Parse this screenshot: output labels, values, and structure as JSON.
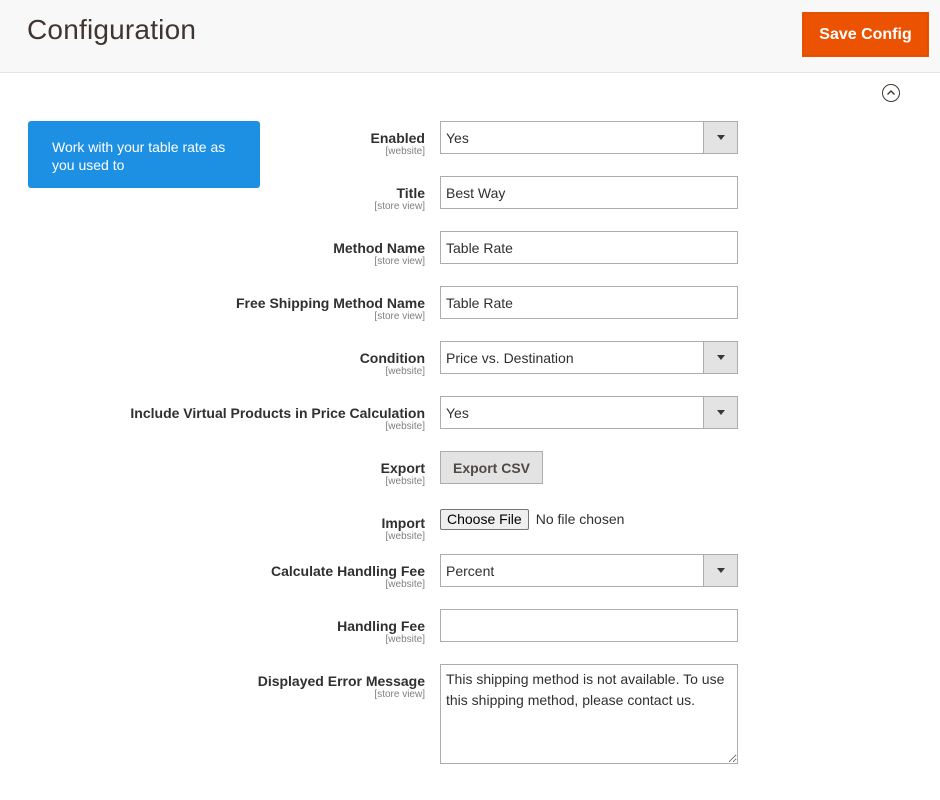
{
  "header": {
    "title": "Configuration",
    "save_button": "Save Config"
  },
  "section": {
    "collapse_icon": "chevron-up-circle-icon",
    "promo_text": "Work with your table rate as you used to"
  },
  "fields": {
    "enabled": {
      "label": "Enabled",
      "scope": "[website]",
      "value": "Yes"
    },
    "title": {
      "label": "Title",
      "scope": "[store view]",
      "value": "Best Way"
    },
    "method_name": {
      "label": "Method Name",
      "scope": "[store view]",
      "value": "Table Rate"
    },
    "free_shipping_method_name": {
      "label": "Free Shipping Method Name",
      "scope": "[store view]",
      "value": "Table Rate"
    },
    "condition": {
      "label": "Condition",
      "scope": "[website]",
      "value": "Price vs. Destination"
    },
    "include_virtual": {
      "label": "Include Virtual Products in Price Calculation",
      "scope": "[website]",
      "value": "Yes"
    },
    "export": {
      "label": "Export",
      "scope": "[website]",
      "button": "Export CSV"
    },
    "import": {
      "label": "Import",
      "scope": "[website]",
      "button": "Choose File",
      "status": "No file chosen"
    },
    "calc_handling_fee": {
      "label": "Calculate Handling Fee",
      "scope": "[website]",
      "value": "Percent"
    },
    "handling_fee": {
      "label": "Handling Fee",
      "scope": "[website]",
      "value": ""
    },
    "error_message": {
      "label": "Displayed Error Message",
      "scope": "[store view]",
      "value": "This shipping method is not available. To use this shipping method, please contact us."
    }
  }
}
